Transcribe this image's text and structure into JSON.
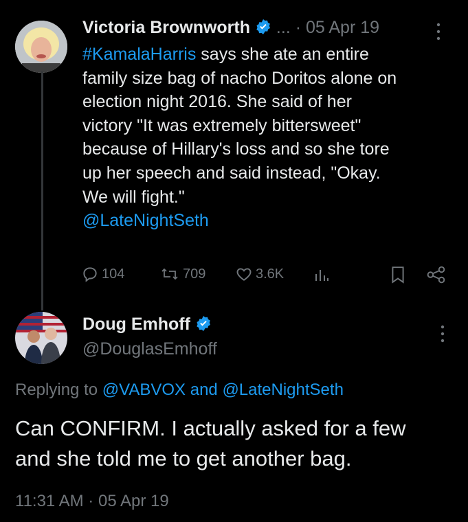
{
  "tweet1": {
    "author_name": "Victoria Brownworth",
    "ellipsis": "...",
    "separator": "·",
    "date": "05 Apr 19",
    "hashtag": "#KamalaHarris",
    "text_lines": [
      " says she ate an entire",
      "family size bag of nacho Doritos alone on",
      "election night 2016. She said of her",
      "victory \"It was extremely bittersweet\"",
      "because of Hillary's loss and so she tore",
      "up her speech and said instead, \"Okay.",
      "We will fight.\""
    ],
    "mention": "@LateNightSeth",
    "replies": "104",
    "retweets": "709",
    "likes": "3.6K"
  },
  "tweet2": {
    "author_name": "Doug Emhoff",
    "handle": "@DouglasEmhoff",
    "replying_prefix": "Replying to ",
    "replying_user1": "@VABVOX",
    "replying_and": " and ",
    "replying_user2": "@LateNightSeth",
    "text_lines": [
      "Can CONFIRM. I actually asked for a few",
      "and she told me to get another bag."
    ],
    "time": "11:31 AM",
    "separator": "·",
    "date": "05 Apr 19"
  },
  "colors": {
    "accent": "#1d9bf0",
    "muted": "#71767b",
    "text": "#e7e9ea",
    "background": "#000000"
  },
  "icons": [
    "verified-icon",
    "more-icon",
    "reply-icon",
    "retweet-icon",
    "like-icon",
    "views-icon",
    "bookmark-icon",
    "share-icon"
  ]
}
